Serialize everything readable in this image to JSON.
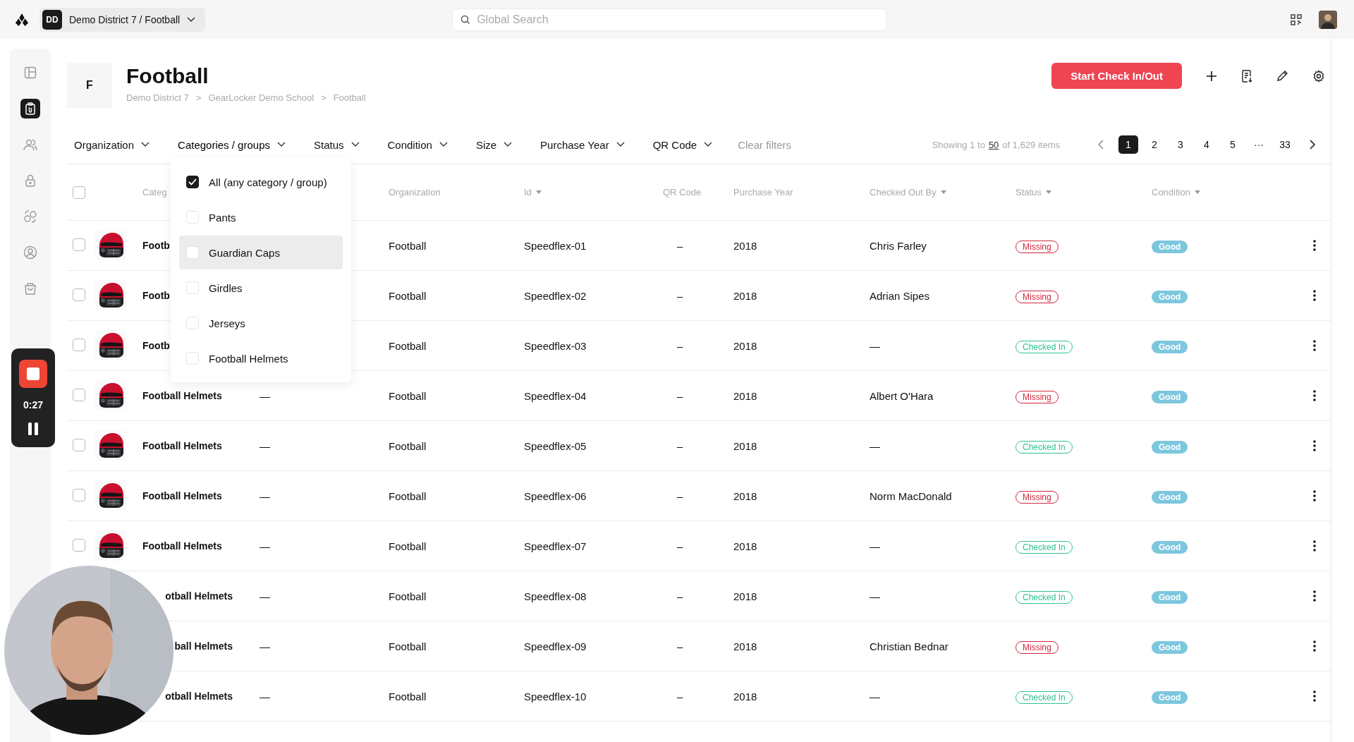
{
  "topbar": {
    "org_initials": "DD",
    "org_name": "Demo District 7 / Football",
    "search_placeholder": "Global Search"
  },
  "header": {
    "initial": "F",
    "title": "Football",
    "breadcrumb": [
      "Demo District 7",
      "GearLocker Demo School",
      "Football"
    ],
    "breadcrumb_separator": ">",
    "primary_button": "Start Check In/Out"
  },
  "filters": [
    {
      "label": "Organization",
      "open": false
    },
    {
      "label": "Categories / groups",
      "open": true
    },
    {
      "label": "Status",
      "open": false
    },
    {
      "label": "Condition",
      "open": false
    },
    {
      "label": "Size",
      "open": false
    },
    {
      "label": "Purchase Year",
      "open": false
    },
    {
      "label": "QR Code",
      "open": false
    }
  ],
  "clear_filters": "Clear filters",
  "showing": {
    "prefix": "Showing 1 to",
    "page_size": "50",
    "suffix": "of 1,629 items"
  },
  "pagination": [
    {
      "label": "1",
      "selected": true
    },
    {
      "label": "2",
      "selected": false
    },
    {
      "label": "3",
      "selected": false
    },
    {
      "label": "4",
      "selected": false
    },
    {
      "label": "5",
      "selected": false
    },
    {
      "label": "···",
      "selected": false
    },
    {
      "label": "33",
      "selected": false
    }
  ],
  "dropdown": [
    {
      "label": "All (any category / group)",
      "checked": true,
      "hovered": false
    },
    {
      "label": "Pants",
      "checked": false,
      "hovered": false
    },
    {
      "label": "Guardian Caps",
      "checked": false,
      "hovered": true
    },
    {
      "label": "Girdles",
      "checked": false,
      "hovered": false
    },
    {
      "label": "Jerseys",
      "checked": false,
      "hovered": false
    },
    {
      "label": "Football Helmets",
      "checked": false,
      "hovered": false
    }
  ],
  "table": {
    "select_all_checked": false,
    "columns": [
      {
        "label": "Categ",
        "sortable": false
      },
      {
        "label": "Organization",
        "sortable": false
      },
      {
        "label": "Id",
        "sortable": true
      },
      {
        "label": "QR Code",
        "sortable": false
      },
      {
        "label": "Purchase Year",
        "sortable": false
      },
      {
        "label": "Checked Out By",
        "sortable": true
      },
      {
        "label": "Status",
        "sortable": true
      },
      {
        "label": "Condition",
        "sortable": true
      }
    ],
    "rows": [
      {
        "kind": "plain",
        "checked": false,
        "name": "Footb",
        "organization": "Football",
        "id": "Speedflex-01",
        "qr": "–",
        "year": "2018",
        "checked_out_by": "Chris Farley",
        "status": {
          "label": "Missing",
          "color": "#d0263c"
        },
        "condition": {
          "label": "Good",
          "color": "#7cc7de"
        }
      },
      {
        "kind": "plain",
        "checked": false,
        "name": "Footb",
        "organization": "Football",
        "id": "Speedflex-02",
        "qr": "–",
        "year": "2018",
        "checked_out_by": "Adrian Sipes",
        "status": {
          "label": "Missing",
          "color": "#d0263c"
        },
        "condition": {
          "label": "Good",
          "color": "#7cc7de"
        }
      },
      {
        "kind": "plain",
        "checked": false,
        "name": "Footb",
        "organization": "Football",
        "id": "Speedflex-03",
        "qr": "–",
        "year": "2018",
        "checked_out_by": "—",
        "status": {
          "label": "Checked In",
          "color": "#2ec48c"
        },
        "condition": {
          "label": "Good",
          "color": "#7cc7de"
        }
      },
      {
        "kind": "plain",
        "checked": false,
        "name": "Football Helmets",
        "column_2": "—",
        "organization": "Football",
        "id": "Speedflex-04",
        "qr": "–",
        "year": "2018",
        "checked_out_by": "Albert O'Hara",
        "status": {
          "label": "Missing",
          "color": "#d0263c"
        },
        "condition": {
          "label": "Good",
          "color": "#7cc7de"
        }
      },
      {
        "kind": "plain",
        "checked": false,
        "name": "Football Helmets",
        "column_2": "—",
        "organization": "Football",
        "id": "Speedflex-05",
        "qr": "–",
        "year": "2018",
        "checked_out_by": "—",
        "status": {
          "label": "Checked In",
          "color": "#2ec48c"
        },
        "condition": {
          "label": "Good",
          "color": "#7cc7de"
        }
      },
      {
        "kind": "plain",
        "checked": false,
        "name": "Football Helmets",
        "column_2": "—",
        "organization": "Football",
        "id": "Speedflex-06",
        "qr": "–",
        "year": "2018",
        "checked_out_by": "Norm MacDonald",
        "status": {
          "label": "Missing",
          "color": "#d0263c"
        },
        "condition": {
          "label": "Good",
          "color": "#7cc7de"
        }
      },
      {
        "kind": "plain",
        "checked": false,
        "name": "Football Helmets",
        "column_2": "—",
        "organization": "Football",
        "id": "Speedflex-07",
        "qr": "–",
        "year": "2018",
        "checked_out_by": "—",
        "status": {
          "label": "Checked In",
          "color": "#2ec48c"
        },
        "condition": {
          "label": "Good",
          "color": "#7cc7de"
        }
      },
      {
        "kind": "overlapped",
        "name": "otball Helmets",
        "column_2": "—",
        "organization": "Football",
        "id": "Speedflex-08",
        "qr": "–",
        "year": "2018",
        "checked_out_by": "—",
        "status": {
          "label": "Checked In",
          "color": "#2ec48c"
        },
        "condition": {
          "label": "Good",
          "color": "#7cc7de"
        }
      },
      {
        "kind": "overlapped",
        "name": "ball Helmets",
        "column_2": "—",
        "organization": "Football",
        "id": "Speedflex-09",
        "qr": "–",
        "year": "2018",
        "checked_out_by": "Christian Bednar",
        "status": {
          "label": "Missing",
          "color": "#d0263c"
        },
        "condition": {
          "label": "Good",
          "color": "#7cc7de"
        }
      },
      {
        "kind": "overlapped",
        "name": "otball Helmets",
        "column_2": "—",
        "organization": "Football",
        "id": "Speedflex-10",
        "qr": "–",
        "year": "2018",
        "checked_out_by": "—",
        "status": {
          "label": "Checked In",
          "color": "#2ec48c"
        },
        "condition": {
          "label": "Good",
          "color": "#7cc7de"
        }
      }
    ]
  },
  "recording": {
    "time": "0:27"
  }
}
